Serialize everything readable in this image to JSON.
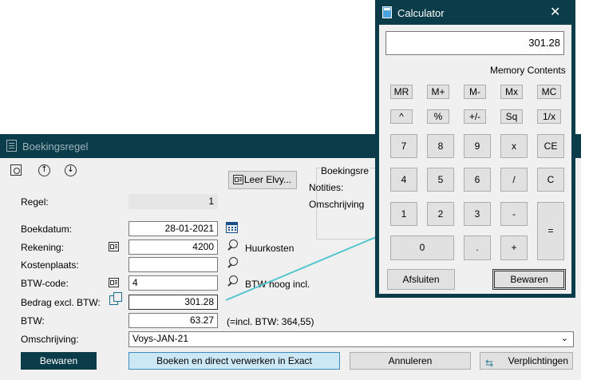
{
  "booking": {
    "title": "Boekingsregel",
    "leer_label": "Leer Elvy...",
    "group_title": "Boekingsre",
    "notities_label": "Notities:",
    "omschrijving_partial": "Omschrijving",
    "regel_label": "Regel:",
    "regel_value": "1",
    "boekdatum_label": "Boekdatum:",
    "boekdatum_value": "28-01-2021",
    "rekening_label": "Rekening:",
    "rekening_value": "4200",
    "rekening_desc": "Huurkosten",
    "kostenplaats_label": "Kostenplaats:",
    "kostenplaats_value": "",
    "btwcode_label": "BTW-code:",
    "btwcode_value": "4",
    "btwcode_desc": "BTW hoog incl.",
    "bedrag_label": "Bedrag excl. BTW:",
    "bedrag_value": "301.28",
    "btw_label": "BTW:",
    "btw_value": "63.27",
    "btw_note": "(=incl. BTW: 364,55)",
    "omschrijving_label": "Omschrijving:",
    "omschrijving_value": "Voys-JAN-21",
    "buttons": {
      "bewaren": "Bewaren",
      "boeken": "Boeken en direct verwerken in Exact",
      "annuleren": "Annuleren",
      "verplichtingen": "Verplichtingen"
    }
  },
  "calculator": {
    "title": "Calculator",
    "close": "✕",
    "display": "301.28",
    "memory_label": "Memory Contents",
    "row_mem": [
      "MR",
      "M+",
      "M-",
      "Mx",
      "MC"
    ],
    "row_fn": [
      "^",
      "%",
      "+/-",
      "Sq",
      "1/x"
    ],
    "row1": [
      "7",
      "8",
      "9",
      "x",
      "CE"
    ],
    "row2": [
      "4",
      "5",
      "6",
      "/",
      "C"
    ],
    "row3": [
      "1",
      "2",
      "3",
      "-",
      "="
    ],
    "row4": [
      "0",
      ".",
      "+"
    ],
    "afsluiten": "Afsluiten",
    "bewaren": "Bewaren"
  },
  "colors": {
    "titlebar": "#0b3c49",
    "connector": "#4fc6cf"
  }
}
